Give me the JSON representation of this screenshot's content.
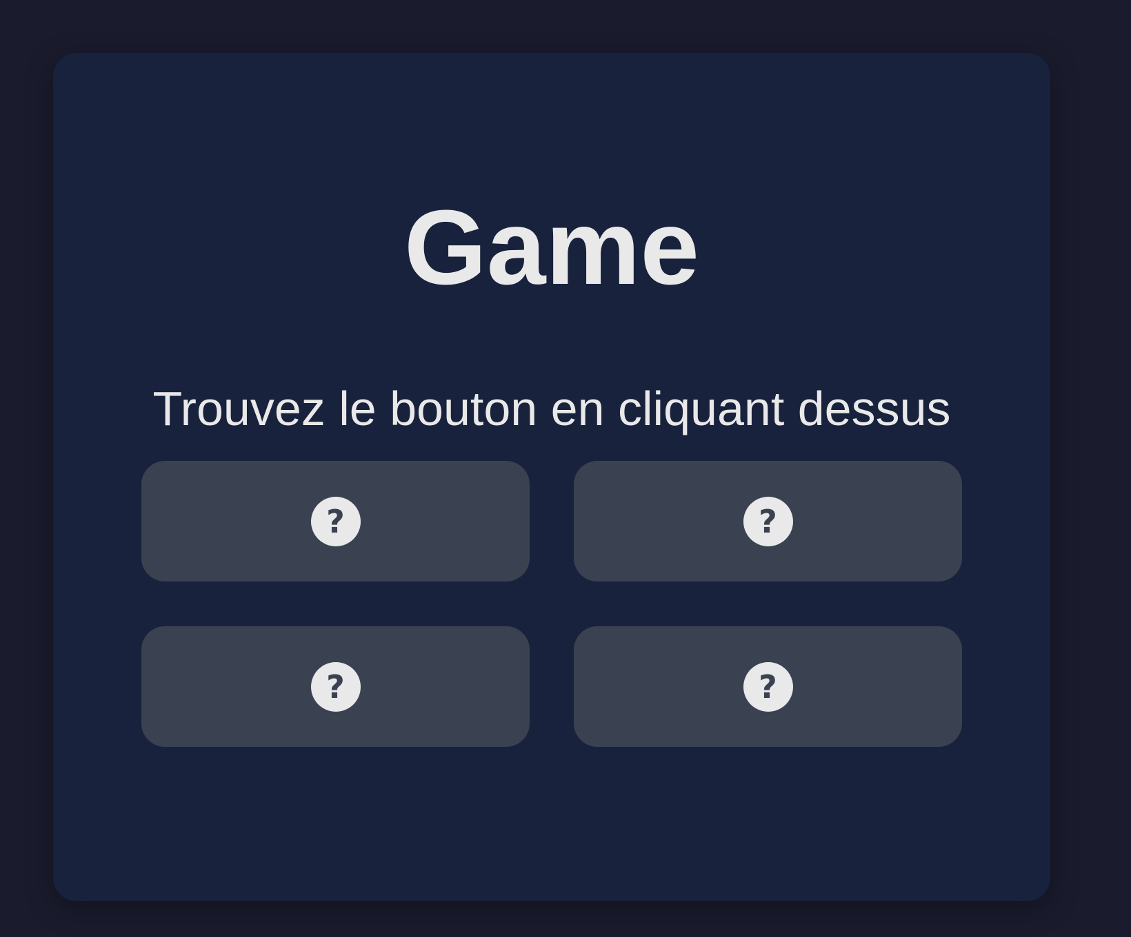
{
  "game": {
    "title": "Game",
    "instruction": "Trouvez le bouton en cliquant dessus",
    "tiles": [
      {
        "icon": "question-icon",
        "glyph": "?"
      },
      {
        "icon": "question-icon",
        "glyph": "?"
      },
      {
        "icon": "question-icon",
        "glyph": "?"
      },
      {
        "icon": "question-icon",
        "glyph": "?"
      }
    ]
  },
  "colors": {
    "page_background": "#1a1c2e",
    "card_background": "#18223c",
    "tile_background": "#3a4252",
    "text": "#e9e9ea"
  }
}
